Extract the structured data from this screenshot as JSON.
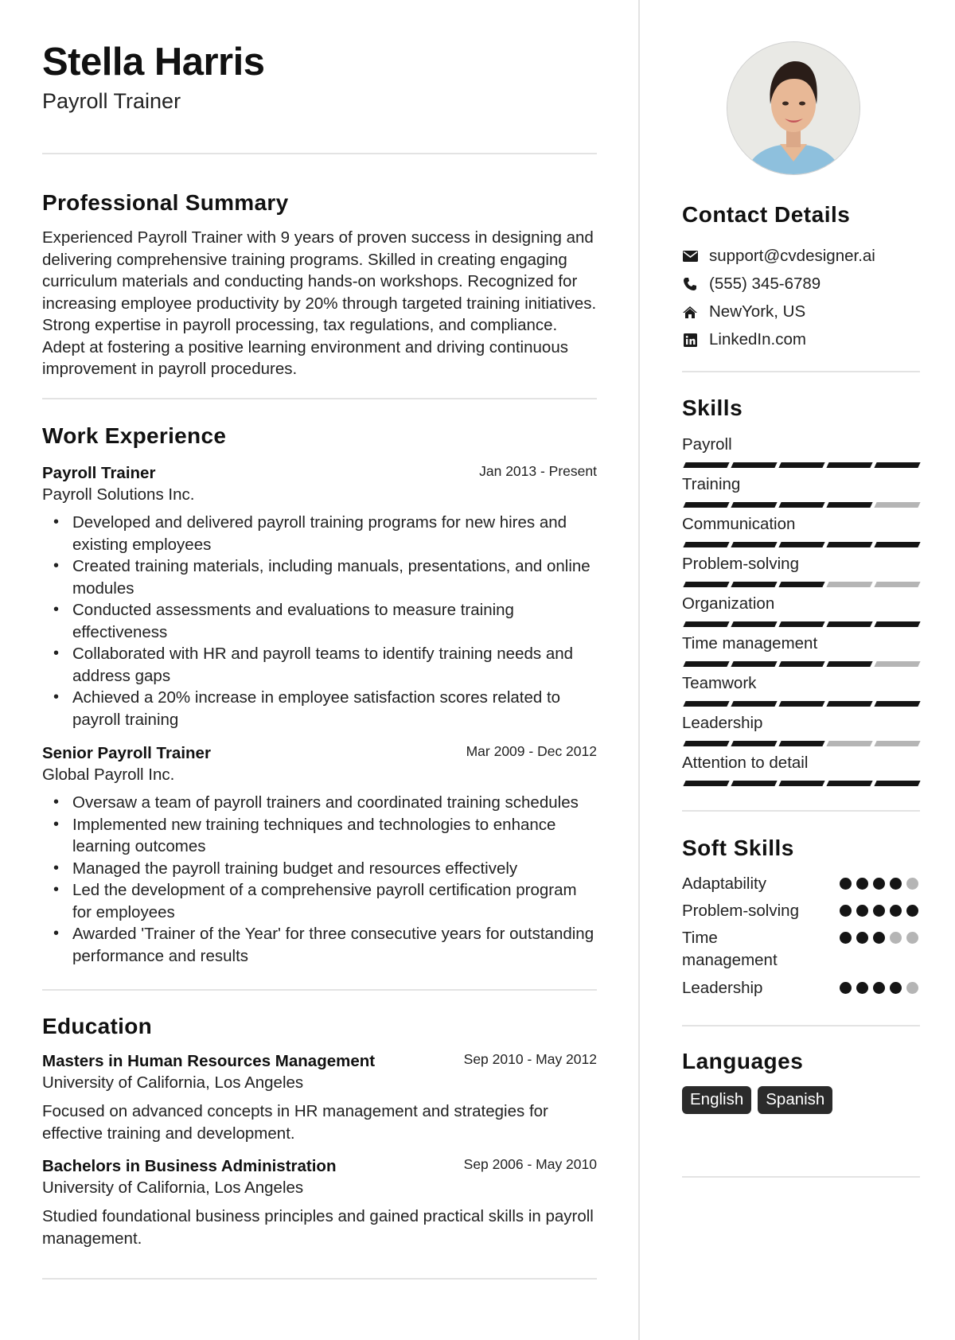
{
  "header": {
    "name": "Stella Harris",
    "title": "Payroll Trainer"
  },
  "summary": {
    "heading": "Professional Summary",
    "text": "Experienced Payroll Trainer with 9 years of proven success in designing and delivering comprehensive training programs. Skilled in creating engaging curriculum materials and conducting hands-on workshops. Recognized for increasing employee productivity by 20% through targeted training initiatives. Strong expertise in payroll processing, tax regulations, and compliance. Adept at fostering a positive learning environment and driving continuous improvement in payroll procedures."
  },
  "experience": {
    "heading": "Work Experience",
    "jobs": [
      {
        "title": "Payroll Trainer",
        "date": "Jan 2013 - Present",
        "org": "Payroll Solutions Inc.",
        "bullets": [
          "Developed and delivered payroll training programs for new hires and existing employees",
          "Created training materials, including manuals, presentations, and online modules",
          "Conducted assessments and evaluations to measure training effectiveness",
          "Collaborated with HR and payroll teams to identify training needs and address gaps",
          "Achieved a 20% increase in employee satisfaction scores related to payroll training"
        ]
      },
      {
        "title": "Senior Payroll Trainer",
        "date": "Mar 2009 - Dec 2012",
        "org": "Global Payroll Inc.",
        "bullets": [
          "Oversaw a team of payroll trainers and coordinated training schedules",
          "Implemented new training techniques and technologies to enhance learning outcomes",
          "Managed the payroll training budget and resources effectively",
          "Led the development of a comprehensive payroll certification program for employees",
          "Awarded 'Trainer of the Year' for three consecutive years for outstanding performance and results"
        ]
      }
    ]
  },
  "education": {
    "heading": "Education",
    "items": [
      {
        "degree": "Masters in Human Resources Management",
        "date": "Sep 2010 - May 2012",
        "school": "University of California, Los Angeles",
        "description": "Focused on advanced concepts in HR management and strategies for effective training and development."
      },
      {
        "degree": "Bachelors in Business Administration",
        "date": "Sep 2006 - May 2010",
        "school": "University of California, Los Angeles",
        "description": "Studied foundational business principles and gained practical skills in payroll management."
      }
    ]
  },
  "contact": {
    "heading": "Contact Details",
    "items": [
      {
        "icon": "envelope-icon",
        "text": "support@cvdesigner.ai"
      },
      {
        "icon": "phone-icon",
        "text": "(555) 345-6789"
      },
      {
        "icon": "home-icon",
        "text": "NewYork, US"
      },
      {
        "icon": "linkedin-icon",
        "text": "LinkedIn.com"
      }
    ]
  },
  "skills": {
    "heading": "Skills",
    "max": 5,
    "items": [
      {
        "name": "Payroll",
        "level": 5
      },
      {
        "name": "Training",
        "level": 4
      },
      {
        "name": "Communication",
        "level": 5
      },
      {
        "name": "Problem-solving",
        "level": 3
      },
      {
        "name": "Organization",
        "level": 5
      },
      {
        "name": "Time management",
        "level": 4
      },
      {
        "name": "Teamwork",
        "level": 5
      },
      {
        "name": "Leadership",
        "level": 3
      },
      {
        "name": "Attention to detail",
        "level": 5
      }
    ]
  },
  "soft_skills": {
    "heading": "Soft Skills",
    "max": 5,
    "items": [
      {
        "name": "Adaptability",
        "level": 4
      },
      {
        "name": "Problem-solving",
        "level": 5
      },
      {
        "name": "Time management",
        "level": 3
      },
      {
        "name": "Leadership",
        "level": 4
      }
    ]
  },
  "languages": {
    "heading": "Languages",
    "items": [
      "English",
      "Spanish"
    ]
  },
  "colors": {
    "filled": "#151515",
    "empty": "#b5b5b5",
    "badge": "#2b2b2b",
    "divider": "#e3e3e3"
  }
}
